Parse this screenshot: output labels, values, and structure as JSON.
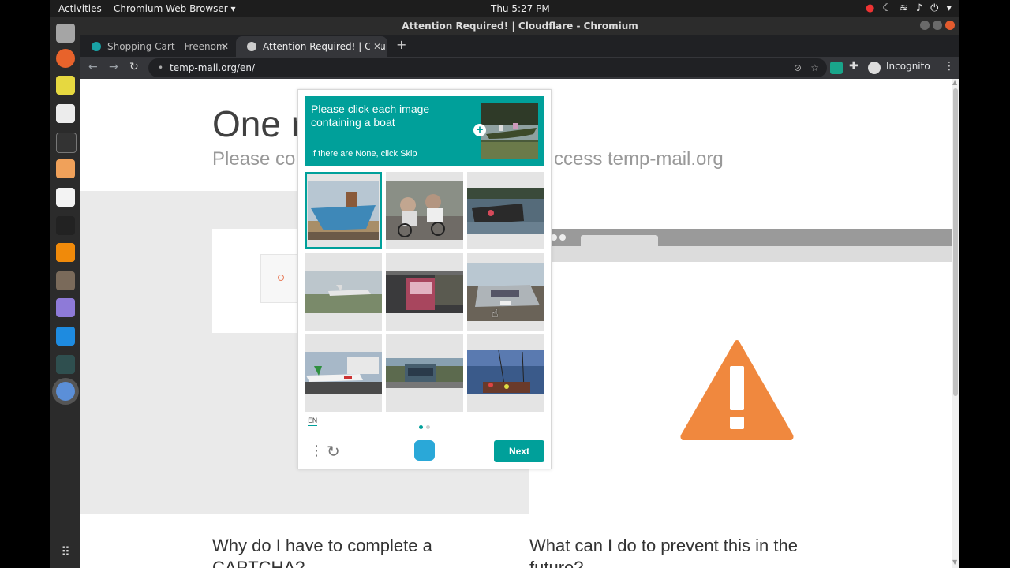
{
  "topbar": {
    "activities": "Activities",
    "app_menu": "Chromium Web Browser ▾",
    "clock": "Thu  5:27 PM",
    "tray_icons": [
      "record-icon",
      "night-light-icon",
      "wifi-icon",
      "volume-icon",
      "power-icon",
      "chevron-down-icon"
    ]
  },
  "dock": {
    "items": [
      "files-icon",
      "firefox-icon",
      "settings-icon",
      "text-editor-icon",
      "terminal-icon",
      "document-icon",
      "pdf-icon",
      "inkscape-icon",
      "vlc-icon",
      "gimp-icon",
      "app-icon",
      "vscode-icon",
      "system-monitor-icon",
      "chromium-icon",
      "app-grid-icon"
    ]
  },
  "window": {
    "title": "Attention Required! | Cloudflare - Chromium"
  },
  "tabs": [
    {
      "title": "Shopping Cart - Freenom",
      "close": "✕",
      "favicon_color": "#19a2a5"
    },
    {
      "title": "Attention Required! | Clou",
      "close": "✕",
      "favicon_color": "#cccccc"
    }
  ],
  "toolbar": {
    "back": "←",
    "forward": "→",
    "reload": "↻",
    "url": "temp-mail.org/en/",
    "incognito_label": "Incognito",
    "menu": "⋮"
  },
  "page": {
    "heading_visible": "One r",
    "subtitle_left": "Please com",
    "subtitle_right": "ccess temp-mail.org",
    "question_left": "Why do I have to complete a CAPTCHA?",
    "question_right": "What can I do to prevent this in the future?"
  },
  "captcha": {
    "prompt": "Please click each image containing a boat",
    "skip_hint": "If there are None, click Skip",
    "language": "EN",
    "next_label": "Next",
    "accent": "#00a09a",
    "images": [
      {
        "subject": "boat on beach",
        "selected": true
      },
      {
        "subject": "cyclists",
        "selected": false
      },
      {
        "subject": "flooded vehicle",
        "selected": false
      },
      {
        "subject": "airplane on runway",
        "selected": false
      },
      {
        "subject": "bus at night",
        "selected": false
      },
      {
        "subject": "silver car",
        "selected": false
      },
      {
        "subject": "airplane at airport",
        "selected": false
      },
      {
        "subject": "car on road",
        "selected": false
      },
      {
        "subject": "boats in harbor",
        "selected": false
      }
    ]
  }
}
